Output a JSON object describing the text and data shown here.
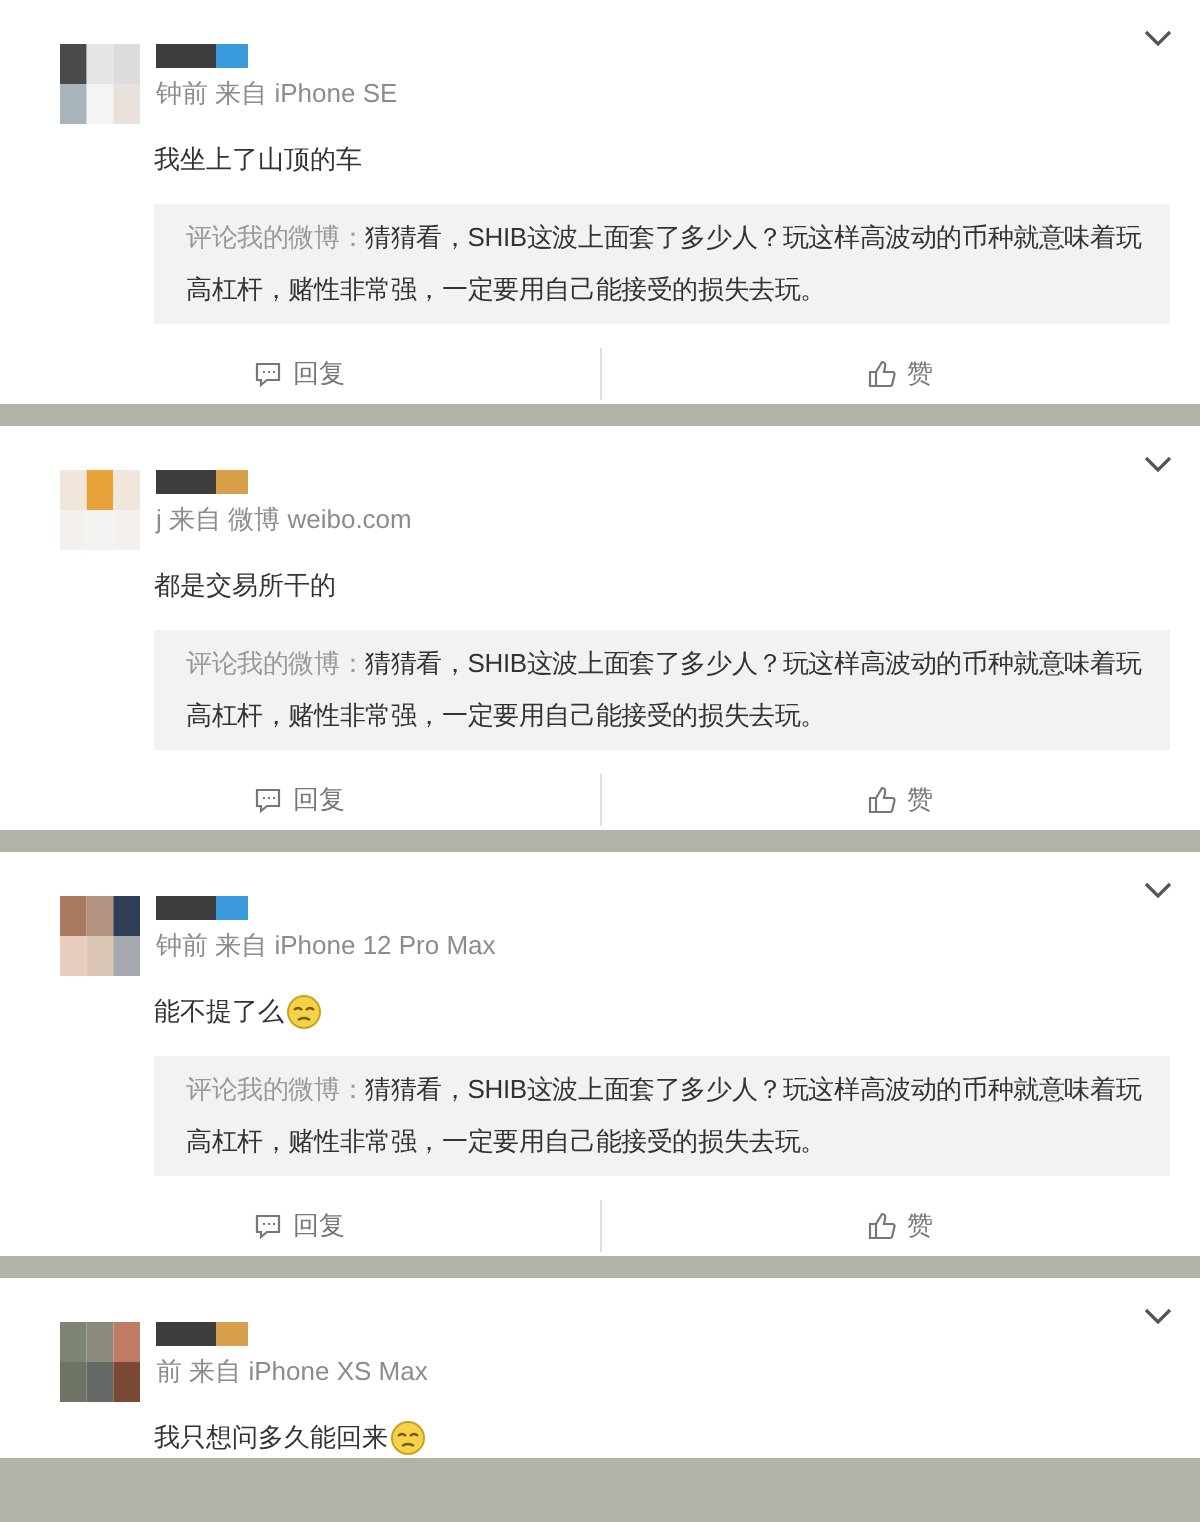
{
  "comments": [
    {
      "meta": "钟前 来自 iPhone SE",
      "text": "我坐上了山顶的车",
      "emoji": false,
      "quote": {
        "label": "评论我的微博：",
        "text": "猜猜看，SHIB这波上面套了多少人？玩这样高波动的币种就意味着玩高杠杆，赌性非常强，一定要用自己能接受的损失去玩。"
      },
      "reply": "回复",
      "like": "赞"
    },
    {
      "meta": "j 来自 微博 weibo.com",
      "text": "都是交易所干的",
      "emoji": false,
      "quote": {
        "label": "评论我的微博：",
        "text": "猜猜看，SHIB这波上面套了多少人？玩这样高波动的币种就意味着玩高杠杆，赌性非常强，一定要用自己能接受的损失去玩。"
      },
      "reply": "回复",
      "like": "赞"
    },
    {
      "meta": "钟前 来自 iPhone 12 Pro Max",
      "text": "能不提了么",
      "emoji": true,
      "quote": {
        "label": "评论我的微博：",
        "text": "猜猜看，SHIB这波上面套了多少人？玩这样高波动的币种就意味着玩高杠杆，赌性非常强，一定要用自己能接受的损失去玩。"
      },
      "reply": "回复",
      "like": "赞"
    },
    {
      "meta": "前 来自 iPhone XS Max",
      "text": "我只想问多久能回来",
      "emoji": true
    }
  ]
}
